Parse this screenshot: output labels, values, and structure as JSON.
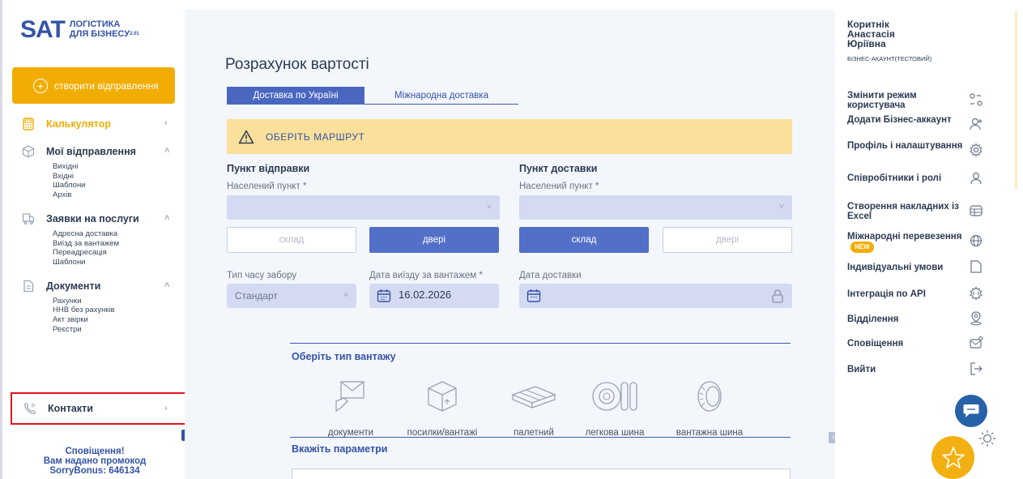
{
  "logo": {
    "brand": "SAT",
    "line1": "ЛОГІСТИКА",
    "line2": "ДЛЯ БІЗНЕСУ",
    "version": "2.01"
  },
  "sidebar": {
    "create_button": "створити відправлення",
    "calculator": "Калькулятор",
    "shipments": {
      "label": "Мої відправлення",
      "items": [
        "Вихідні",
        "Вхідні",
        "Шаблони",
        "Архів"
      ]
    },
    "services": {
      "label": "Заявки на послуги",
      "items": [
        "Адресна доставка",
        "Виїзд за вантажем",
        "Переадресація",
        "Шаблони"
      ]
    },
    "documents": {
      "label": "Документи",
      "items": [
        "Рахунки",
        "ННВ без рахунків",
        "Акт звірки",
        "Реєстри"
      ]
    },
    "contacts": "Контакти",
    "collapse": "«",
    "notice": {
      "line1": "Сповіщення!",
      "line2": "Вам надано промокод",
      "line3": "SorryBonus: 646134"
    }
  },
  "main": {
    "title": "Розрахунок вартості",
    "tabs": [
      {
        "label": "Доставка по Україні"
      },
      {
        "label": "Міжнародна доставка"
      }
    ],
    "route_banner": "ОБЕРІТЬ МАРШРУТ",
    "origin": {
      "title": "Пункт відправки",
      "city_label": "Населений пункт *",
      "warehouse": "склад",
      "door": "двері"
    },
    "destination": {
      "title": "Пункт доставки",
      "city_label": "Населений пункт *",
      "warehouse": "склад",
      "door": "двері"
    },
    "pickup_type": {
      "label": "Тип часу забору",
      "value": "Стандарт"
    },
    "pickup_date": {
      "label": "Дата виїзду за вантажем *",
      "value": "16.02.2026"
    },
    "delivery_date": {
      "label": "Дата доставки",
      "value": ""
    },
    "cargo_title": "Оберіть тип вантажу",
    "cargo_types": [
      "документи",
      "посилки/вантажі",
      "палетний",
      "легкова шина",
      "вантажна шина"
    ],
    "params_title": "Вкажіть параметри",
    "expand": "»"
  },
  "user": {
    "name_line1": "Коритнік",
    "name_line2": "Анастасія",
    "name_line3": "Юріївна",
    "account": "БІЗНЕС-АКАУНТ(ТЕСТОВИЙ)"
  },
  "menu": {
    "switch_mode": "Змінити режим користувача",
    "add_account": "Додати Бізнес-аккаунт",
    "profile": "Профіль і налаштування",
    "employees": "Співробітники і ролі",
    "excel": "Створення накладних із Excel",
    "international": "Міжнародні перевезення",
    "new_badge": "NEW",
    "conditions": "Індивідуальні умови",
    "api": "Інтеграція по API",
    "branches": "Відділення",
    "notifications": "Сповіщення",
    "logout": "Вийти"
  },
  "colors": {
    "brand_blue": "#3453a6",
    "accent_yellow": "#f2ad05",
    "highlight_red": "#e0161e"
  }
}
